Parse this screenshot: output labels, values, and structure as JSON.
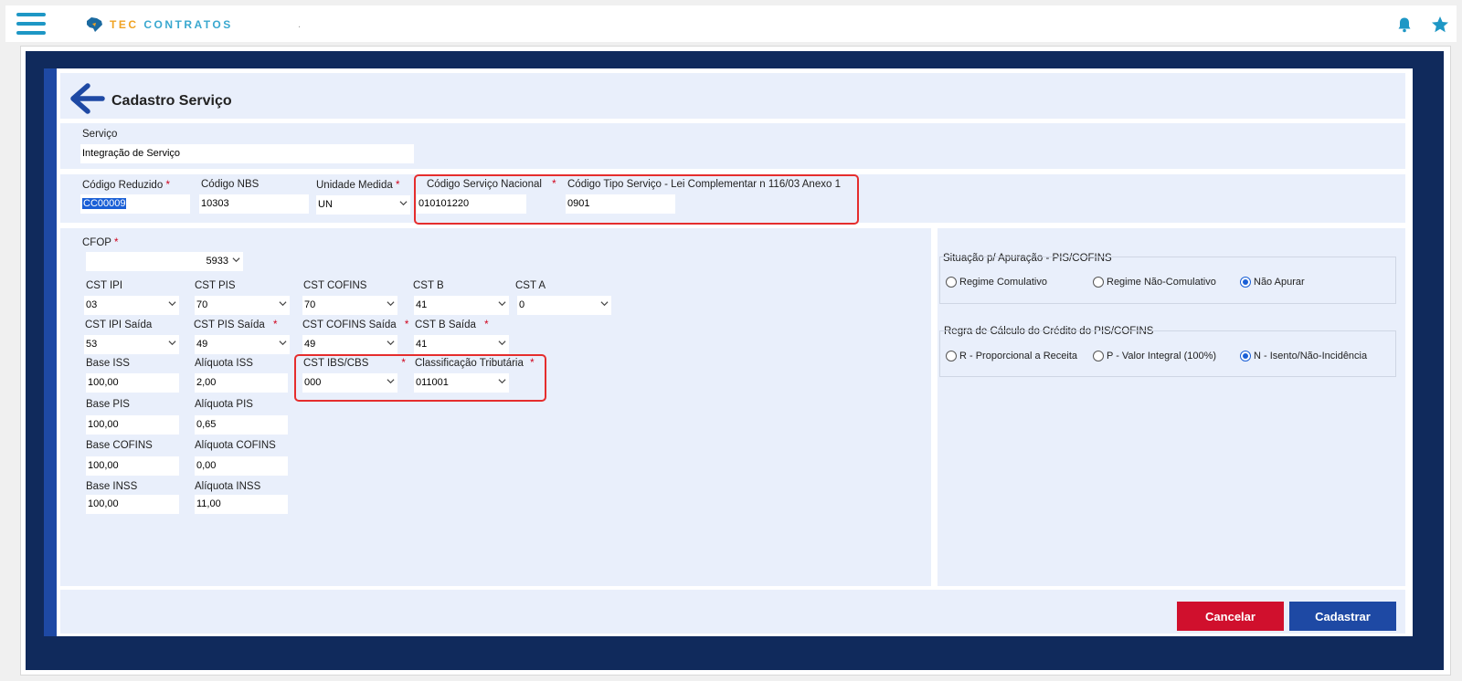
{
  "header": {
    "logo_part1": "TEC",
    "logo_part2": "CONTRATOS",
    "dot": "."
  },
  "page": {
    "title": "Cadastro Serviço"
  },
  "servico": {
    "label": "Serviço",
    "value": "Integração de Serviço"
  },
  "codigos": {
    "reduzido_label": "Código Reduzido",
    "reduzido_value": "CC00009",
    "nbs_label": "Código NBS",
    "nbs_value": "10303",
    "unidade_label": "Unidade Medida",
    "unidade_value": "UN",
    "nacional_label": "Código Serviço Nacional",
    "nacional_value": "010101220",
    "tipo_label": "Código Tipo Serviço - Lei Complementar n 116/03 Anexo 1",
    "tipo_value": "0901"
  },
  "required_mark": "*",
  "tax": {
    "cfop_label": "CFOP",
    "cfop_value": "5933",
    "cst_ipi_label": "CST IPI",
    "cst_ipi_value": "03",
    "cst_pis_label": "CST PIS",
    "cst_pis_value": "70",
    "cst_cofins_label": "CST COFINS",
    "cst_cofins_value": "70",
    "cst_b_label": "CST B",
    "cst_b_value": "41",
    "cst_a_label": "CST A",
    "cst_a_value": "0",
    "cst_ipi_saida_label": "CST IPI Saída",
    "cst_ipi_saida_value": "53",
    "cst_pis_saida_label": "CST PIS Saída",
    "cst_pis_saida_value": "49",
    "cst_cofins_saida_label": "CST COFINS Saída",
    "cst_cofins_saida_value": "49",
    "cst_b_saida_label": "CST B Saída",
    "cst_b_saida_value": "41",
    "base_iss_label": "Base ISS",
    "base_iss_value": "100,00",
    "aliq_iss_label": "Alíquota ISS",
    "aliq_iss_value": "2,00",
    "cst_ibs_label": "CST IBS/CBS",
    "cst_ibs_value": "000",
    "class_trib_label": "Classificação Tributária",
    "class_trib_value": "011001",
    "base_pis_label": "Base PIS",
    "base_pis_value": "100,00",
    "aliq_pis_label": "Alíquota PIS",
    "aliq_pis_value": "0,65",
    "base_cofins_label": "Base COFINS",
    "base_cofins_value": "100,00",
    "aliq_cofins_label": "Alíquota COFINS",
    "aliq_cofins_value": "0,00",
    "base_inss_label": "Base INSS",
    "base_inss_value": "100,00",
    "aliq_inss_label": "Alíquota INSS",
    "aliq_inss_value": "11,00"
  },
  "situacao": {
    "legend": "Situação p/ Apuração - PIS/COFINS",
    "options": [
      "Regime Comulativo",
      "Regime Não-Comulativo",
      "Não Apurar"
    ],
    "selected": "Não Apurar"
  },
  "regra": {
    "legend": "Regra de Cálculo do Crédito do PIS/COFINS",
    "options": [
      "R - Proporcional a Receita",
      "P - Valor Integral (100%)",
      "N - Isento/Não-Incidência"
    ],
    "selected": "N - Isento/Não-Incidência"
  },
  "actions": {
    "cancel": "Cancelar",
    "submit": "Cadastrar"
  },
  "colors": {
    "navy_frame": "#102a5c",
    "section_bg": "#e9effb",
    "accent_blue": "#1e49a4",
    "cancel_red": "#d0102d",
    "submit_blue": "#1e49a4",
    "highlight_red": "#e52d2d"
  }
}
